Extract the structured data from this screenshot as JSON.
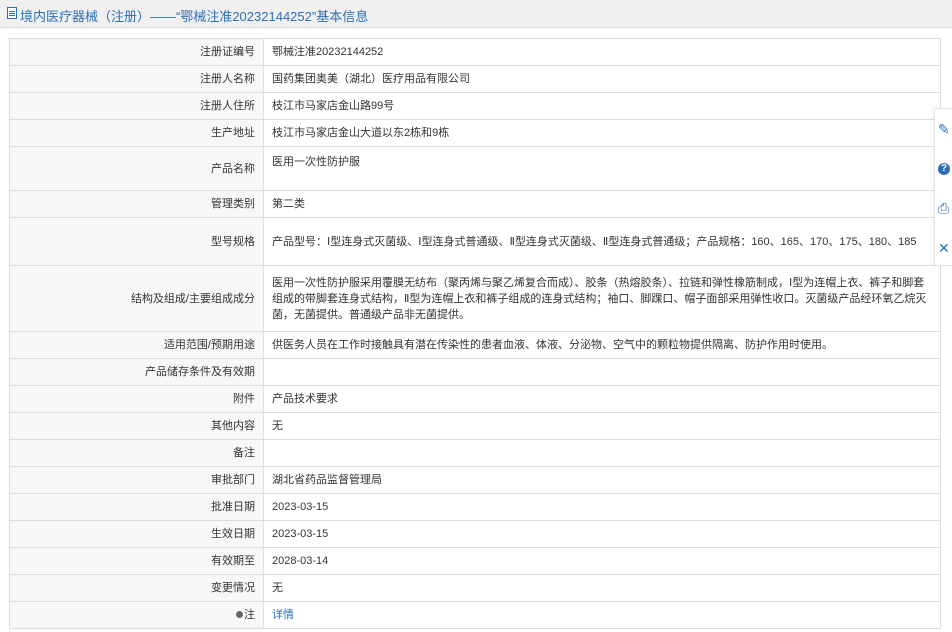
{
  "header": {
    "title": "境内医疗器械（注册）——“鄂械注准20232144252”基本信息"
  },
  "rows": [
    {
      "label": "注册证编号",
      "value": "鄂械注准20232144252"
    },
    {
      "label": "注册人名称",
      "value": "国药集团奥美（湖北）医疗用品有限公司"
    },
    {
      "label": "注册人住所",
      "value": "枝江市马家店金山路99号"
    },
    {
      "label": "生产地址",
      "value": "枝江市马家店金山大道以东2栋和9栋"
    },
    {
      "label": "产品名称",
      "value": "医用一次性防护服"
    },
    {
      "label": "管理类别",
      "value": "第二类"
    },
    {
      "label": "型号规格",
      "value": "产品型号：Ⅰ型连身式灭菌级、Ⅰ型连身式普通级、Ⅱ型连身式灭菌级、Ⅱ型连身式普通级；产品规格：160、165、170、175、180、185"
    },
    {
      "label": "结构及组成/主要组成成分",
      "value": "医用一次性防护服采用覆膜无纺布（聚丙烯与聚乙烯复合而成）、胶条（热熔胶条）、拉链和弹性橡筋制成，Ⅰ型为连帽上衣、裤子和脚套组成的带脚套连身式结构，Ⅱ型为连帽上衣和裤子组成的连身式结构；袖口、脚踝口、帽子面部采用弹性收口。灭菌级产品经环氧乙烷灭菌，无菌提供。普通级产品非无菌提供。"
    },
    {
      "label": "适用范围/预期用途",
      "value": "供医务人员在工作时接触具有潜在传染性的患者血液、体液、分泌物、空气中的颗粒物提供隔离、防护作用时使用。"
    },
    {
      "label": "产品储存条件及有效期",
      "value": ""
    },
    {
      "label": "附件",
      "value": "产品技术要求"
    },
    {
      "label": "其他内容",
      "value": "无"
    },
    {
      "label": "备注",
      "value": ""
    },
    {
      "label": "审批部门",
      "value": "湖北省药品监督管理局"
    },
    {
      "label": "批准日期",
      "value": "2023-03-15"
    },
    {
      "label": "生效日期",
      "value": "2023-03-15"
    },
    {
      "label": "有效期至",
      "value": "2028-03-14"
    },
    {
      "label": "变更情况",
      "value": "无"
    }
  ],
  "note_row": {
    "label": "注",
    "link": "详情"
  },
  "side_tools": [
    {
      "icon": "edit-icon",
      "glyph": "✎"
    },
    {
      "icon": "help-icon",
      "glyph": "?"
    },
    {
      "icon": "print-icon",
      "glyph": "⎙"
    },
    {
      "icon": "close-icon",
      "glyph": "✕"
    }
  ]
}
